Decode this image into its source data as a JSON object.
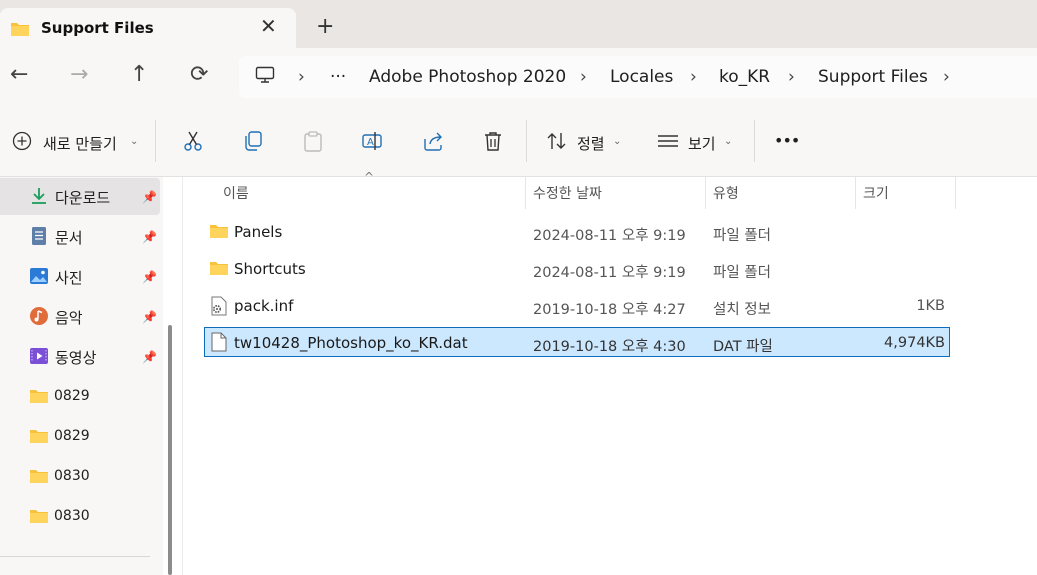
{
  "window": {
    "tab_title": "Support Files",
    "close_glyph": "✕",
    "newtab_glyph": "+"
  },
  "nav": {
    "back_glyph": "←",
    "forward_glyph": "→",
    "up_glyph": "↑",
    "refresh_glyph": "⟳"
  },
  "address": {
    "ellipsis": "···",
    "crumbs": [
      "Adobe Photoshop 2020",
      "Locales",
      "ko_KR",
      "Support Files"
    ],
    "chevron": "›"
  },
  "toolbar": {
    "new_label": "새로 만들기",
    "sort_label": "정렬",
    "view_label": "보기",
    "more_label": "•••",
    "caret": "⌄"
  },
  "sidebar": {
    "items": [
      {
        "label": "다운로드",
        "icon": "download-icon",
        "pinned": true
      },
      {
        "label": "문서",
        "icon": "document-icon",
        "pinned": true
      },
      {
        "label": "사진",
        "icon": "pictures-icon",
        "pinned": true
      },
      {
        "label": "음악",
        "icon": "music-icon",
        "pinned": true
      },
      {
        "label": "동영상",
        "icon": "videos-icon",
        "pinned": true
      },
      {
        "label": "0829",
        "icon": "folder-icon",
        "pinned": false
      },
      {
        "label": "0829",
        "icon": "folder-icon",
        "pinned": false
      },
      {
        "label": "0830",
        "icon": "folder-icon",
        "pinned": false
      },
      {
        "label": "0830",
        "icon": "folder-icon",
        "pinned": false
      }
    ],
    "pin_glyph": "📌"
  },
  "columns": {
    "name": "이름",
    "modified": "수정한 날짜",
    "type": "유형",
    "size": "크기",
    "sort_glyph": "^"
  },
  "files": [
    {
      "name": "Panels",
      "modified": "2024-08-11 오후 9:19",
      "type": "파일 폴더",
      "size": "",
      "icon": "folder-icon"
    },
    {
      "name": "Shortcuts",
      "modified": "2024-08-11 오후 9:19",
      "type": "파일 폴더",
      "size": "",
      "icon": "folder-icon"
    },
    {
      "name": "pack.inf",
      "modified": "2019-10-18 오후 4:27",
      "type": "설치 정보",
      "size": "1KB",
      "icon": "settings-file-icon"
    },
    {
      "name": "tw10428_Photoshop_ko_KR.dat",
      "modified": "2019-10-18 오후 4:30",
      "type": "DAT 파일",
      "size": "4,974KB",
      "icon": "file-icon",
      "selected": true
    }
  ],
  "colors": {
    "accent": "#0f6cbd",
    "selection": "#cce8ff",
    "folder": "#f8c33a"
  }
}
